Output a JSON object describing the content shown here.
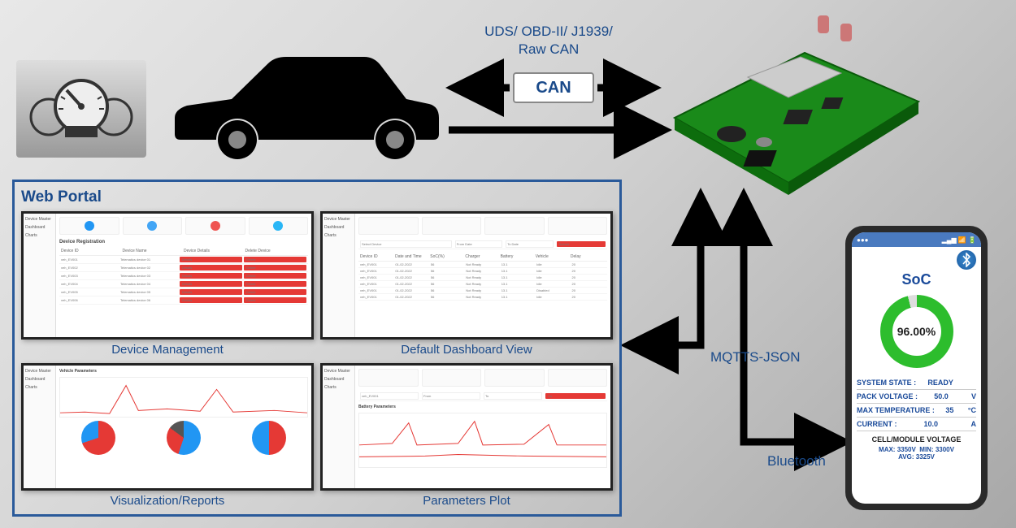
{
  "protocols": {
    "line1": "UDS/ OBD-II/ J1939/",
    "line2": "Raw CAN"
  },
  "can_badge": "CAN",
  "web_portal_title": "Web Portal",
  "panels": {
    "dev_mgmt": {
      "caption": "Device Management",
      "title": "Device Registration",
      "headers": [
        "Device ID",
        "Device Name",
        "Device Details",
        "Delete Device"
      ]
    },
    "dashboard": {
      "caption": "Default Dashboard View"
    },
    "viz": {
      "caption": "Visualization/Reports",
      "section": "Vehicle Parameters"
    },
    "params": {
      "caption": "Parameters Plot",
      "section": "Battery Parameters"
    }
  },
  "sidebar_items": [
    "Device Master",
    "Dashboard",
    "Charts"
  ],
  "mqtts_label": "MQTTS-JSON",
  "bluetooth_label": "Bluetooth",
  "phone": {
    "soc_title": "SoC",
    "soc_value": "96.00%",
    "stats": [
      {
        "label": "SYSTEM STATE :",
        "value": "READY",
        "unit": ""
      },
      {
        "label": "PACK VOLTAGE :",
        "value": "50.0",
        "unit": "V"
      },
      {
        "label": "MAX TEMPERATURE :",
        "value": "35",
        "unit": "°C"
      },
      {
        "label": "CURRENT :",
        "value": "10.0",
        "unit": "A"
      }
    ],
    "cell_header": "CELL/MODULE VOLTAGE",
    "cell_stats": {
      "max": "MAX: 3350V",
      "min": "MIN: 3300V",
      "avg": "AVG: 3325V"
    }
  }
}
